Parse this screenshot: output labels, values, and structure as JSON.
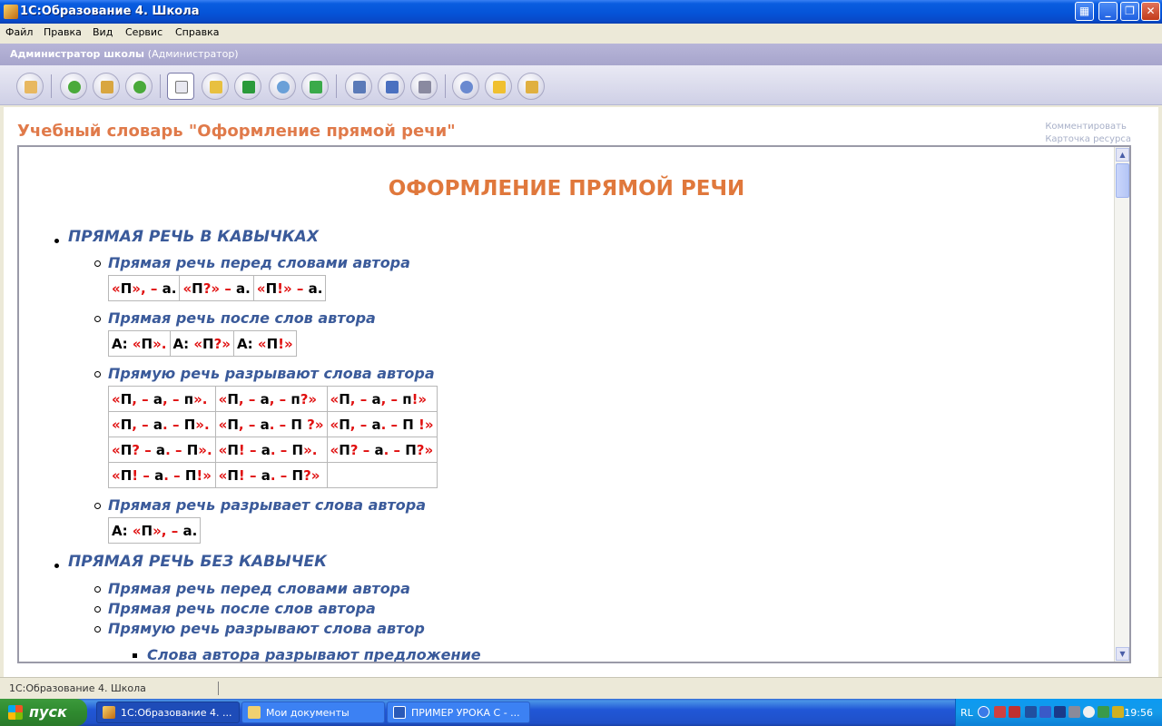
{
  "window": {
    "title": "1С:Образование 4. Школа",
    "buttons": [
      "grid-icon",
      "minimize-icon",
      "restore-icon",
      "close-icon"
    ]
  },
  "menu": [
    "Файл",
    "Правка",
    "Вид",
    "Сервис",
    "Справка"
  ],
  "role": {
    "name": "Администратор школы",
    "sub": "(Администратор)"
  },
  "toolbar": {
    "icons": [
      "exit-icon",
      "back-icon",
      "home-icon",
      "forward-icon",
      "document-icon",
      "book-icon",
      "refresh-icon",
      "attach-icon",
      "upload-icon",
      "fit-icon",
      "monitor-icon",
      "print-icon",
      "search-icon",
      "help-icon",
      "add-icon"
    ]
  },
  "page": {
    "title": "Учебный словарь \"Оформление прямой речи\"",
    "links": [
      "Комментировать",
      "Карточка ресурса"
    ]
  },
  "doc": {
    "heading": "ОФОРМЛЕНИЕ ПРЯМОЙ РЕЧИ",
    "section1": {
      "title": "ПРЯМАЯ РЕЧЬ В КАВЫЧКАХ",
      "s1": {
        "title": "Прямая речь перед словами автора"
      },
      "s2": {
        "title": "Прямая речь после слов автора"
      },
      "s3": {
        "title": "Прямую речь разрывают слова автора"
      },
      "s4": {
        "title": "Прямая речь разрывает слова автора"
      }
    },
    "section2": {
      "title": "ПРЯМАЯ РЕЧЬ БЕЗ КАВЫЧЕК",
      "items": [
        "Прямая речь перед словами автора",
        "Прямая речь после слов автора",
        "Прямую речь разрывают слова автор"
      ],
      "sub": "Слова автора разрывают предложение"
    }
  },
  "status": {
    "text": "1С:Образование 4. Школа"
  },
  "taskbar": {
    "start": "пуск",
    "tasks": [
      "1С:Образование 4. ...",
      "Мои документы",
      "ПРИМЕР УРОКА С - ..."
    ],
    "lang": "RL",
    "clock": "19:56"
  },
  "colors": {
    "accent": "#e0783c",
    "heading": "#3a5a9a",
    "mark": "#e01010"
  }
}
